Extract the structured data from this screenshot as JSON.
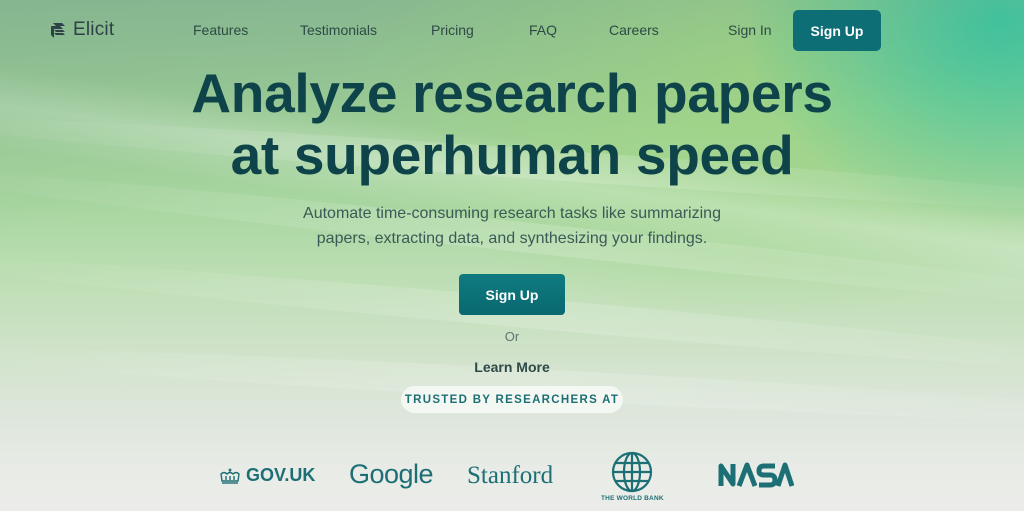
{
  "brand": {
    "name": "Elicit",
    "icon": "stacked-layers-icon"
  },
  "nav": {
    "links": [
      {
        "label": "Features"
      },
      {
        "label": "Testimonials"
      },
      {
        "label": "Pricing"
      },
      {
        "label": "FAQ"
      },
      {
        "label": "Careers"
      }
    ],
    "sign_in": "Sign In",
    "sign_up": "Sign Up"
  },
  "hero": {
    "headline_line1": "Analyze research papers",
    "headline_line2": "at superhuman speed",
    "subtitle_line1": "Automate time-consuming research tasks like summarizing",
    "subtitle_line2": "papers, extracting data, and synthesizing your findings.",
    "cta_primary": "Sign Up",
    "or_text": "Or",
    "cta_secondary": "Learn More"
  },
  "trusted": {
    "label": "TRUSTED BY RESEARCHERS AT",
    "logos": [
      {
        "name": "GOV.UK",
        "icon": "crown-icon"
      },
      {
        "name": "Google"
      },
      {
        "name": "Stanford"
      },
      {
        "name": "THE WORLD BANK",
        "icon": "globe-icon"
      },
      {
        "name": "NASA"
      }
    ]
  },
  "colors": {
    "primary": "#0d6e75",
    "headline": "#0d4349",
    "logo_teal": "#1d6f76"
  }
}
